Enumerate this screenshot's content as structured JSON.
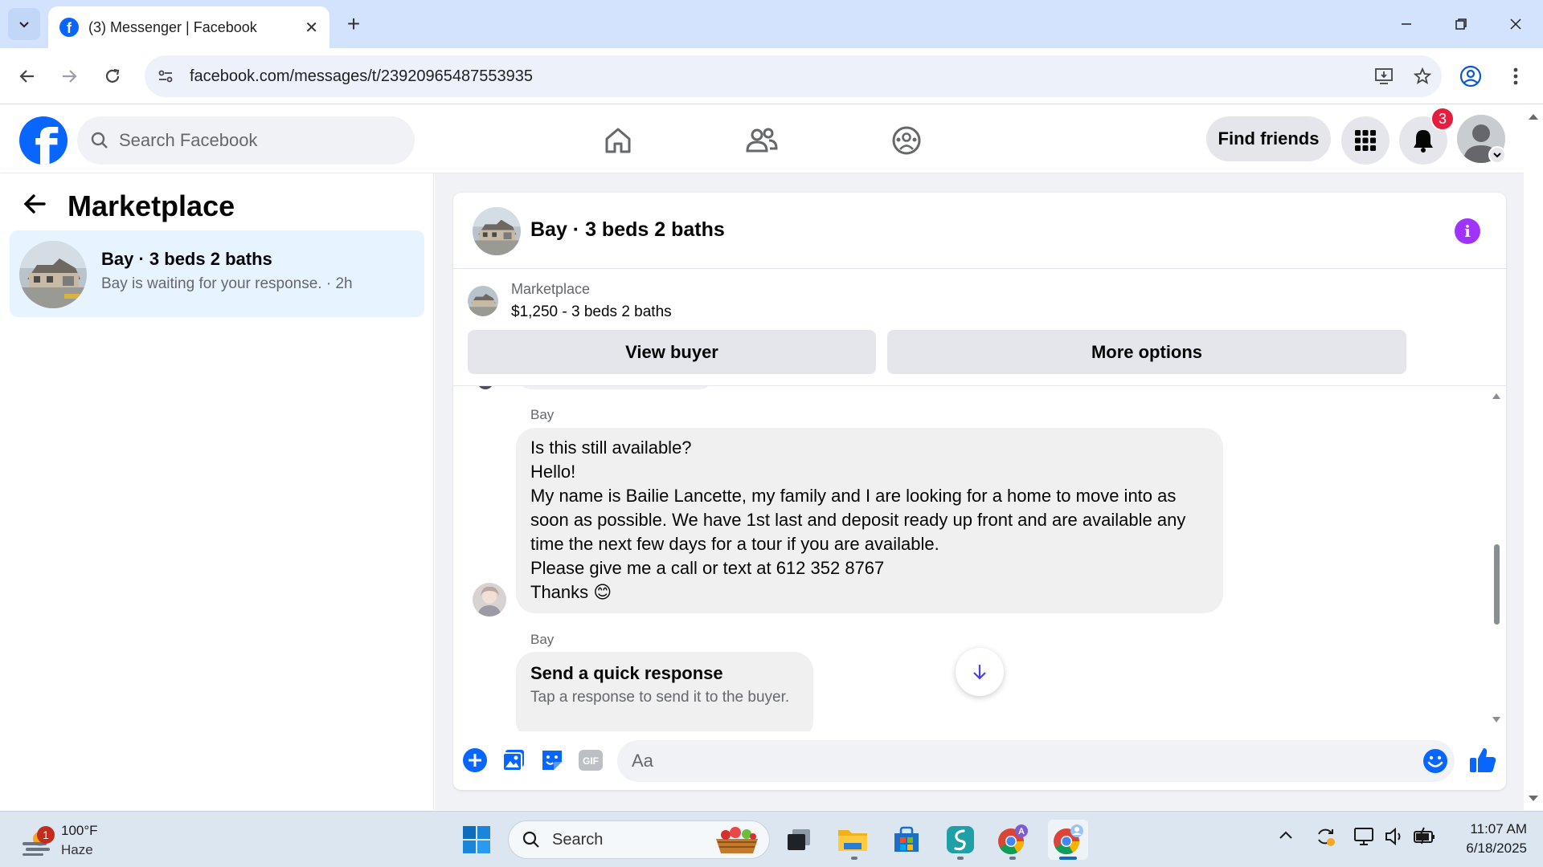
{
  "browser": {
    "tab_title": "(3) Messenger | Facebook",
    "url": "facebook.com/messages/t/23920965487553935"
  },
  "fb_header": {
    "search_placeholder": "Search Facebook",
    "find_friends_label": "Find friends",
    "notification_count": "3"
  },
  "left_panel": {
    "title": "Marketplace",
    "conversations": [
      {
        "title": "Bay · 3 beds 2 baths",
        "subtitle": "Bay is waiting for your response. · 2h"
      }
    ]
  },
  "chat": {
    "title": "Bay · 3 beds 2 baths",
    "listing": {
      "label": "Marketplace",
      "price_title": "$1,250 - 3 beds 2 baths"
    },
    "buttons": {
      "view_buyer": "View buyer",
      "more_options": "More options"
    },
    "messages": [
      {
        "sender": "Bay",
        "lines": [
          "Is this still available?",
          "Hello!",
          "My name is Bailie Lancette, my family and I are looking for a home to move into as",
          "soon as possible. We have 1st last and deposit ready up front and are available any",
          "time the next few days for a tour if you are available.",
          "Please give me a call or text at 612 352 8767",
          "Thanks"
        ],
        "emoji": "😊"
      },
      {
        "sender": "Bay",
        "quick_title": "Send a quick response",
        "quick_sub": "Tap a response to send it to the buyer."
      }
    ],
    "composer_placeholder": "Aa"
  },
  "taskbar": {
    "weather_temp": "100°F",
    "weather_cond": "Haze",
    "weather_badge": "1",
    "search_label": "Search",
    "time": "11:07 AM",
    "date": "6/18/2025"
  },
  "colors": {
    "fb_blue": "#0866ff",
    "selected_bg": "#e7f3ff",
    "info_purple": "#a033ff",
    "badge_red": "#e41e3f"
  }
}
